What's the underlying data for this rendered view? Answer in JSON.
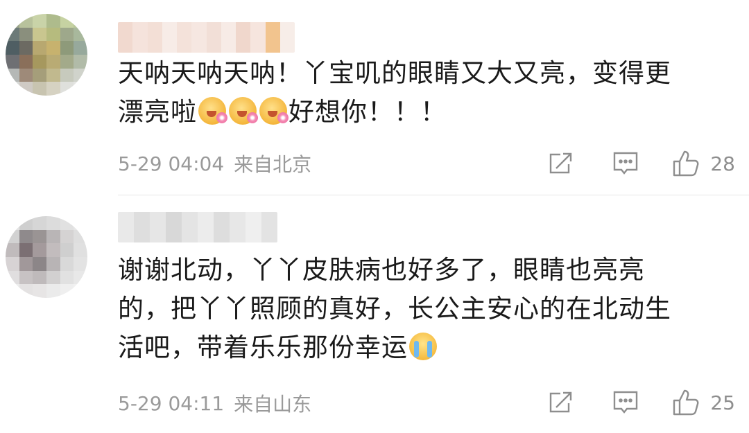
{
  "comments": [
    {
      "text_lines": [
        "天呐天呐天呐！丫宝叽的眼睛又大又亮，变得更",
        "漂亮啦",
        "好想你！！！"
      ],
      "emoji": "flower-face-emoji",
      "date": "5-29 04:04",
      "location": "来自北京",
      "likes": "28"
    },
    {
      "text_lines": [
        "谢谢北动，丫丫皮肤病也好多了，眼睛也亮亮",
        "的，把丫丫照顾的真好，长公主安心的在北动生",
        "活吧，带着乐乐那份幸运"
      ],
      "emoji": "crying-face-emoji",
      "date": "5-29 04:11",
      "location": "来自山东",
      "likes": "25"
    }
  ],
  "icons": {
    "share": "share-icon",
    "comment": "comment-icon",
    "like": "thumbs-up-icon"
  },
  "colors": {
    "text": "#1a1a1a",
    "meta": "#9a9a9a",
    "icon": "#8e8e8e"
  }
}
